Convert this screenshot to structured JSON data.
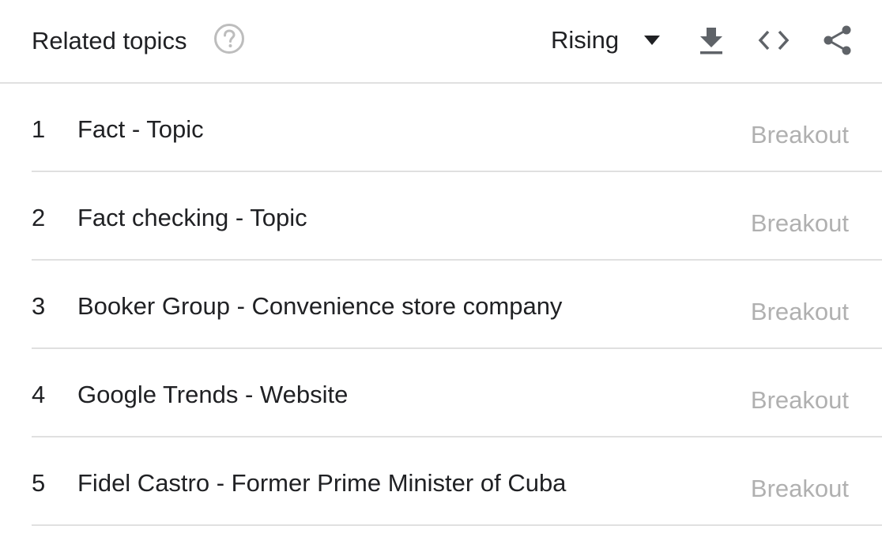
{
  "header": {
    "title": "Related topics",
    "help_icon": "help-circle-icon",
    "filter": {
      "selected": "Rising",
      "icon": "caret-down-icon"
    },
    "actions": [
      {
        "name": "download",
        "icon": "download-icon"
      },
      {
        "name": "embed",
        "icon": "code-icon"
      },
      {
        "name": "share",
        "icon": "share-icon"
      }
    ]
  },
  "topics": [
    {
      "rank": "1",
      "title": "Fact - Topic",
      "value": "Breakout"
    },
    {
      "rank": "2",
      "title": "Fact checking - Topic",
      "value": "Breakout"
    },
    {
      "rank": "3",
      "title": "Booker Group - Convenience store company",
      "value": "Breakout"
    },
    {
      "rank": "4",
      "title": "Google Trends - Website",
      "value": "Breakout"
    },
    {
      "rank": "5",
      "title": "Fidel Castro - Former Prime Minister of Cuba",
      "value": "Breakout"
    }
  ],
  "colors": {
    "text": "#202124",
    "muted": "#b0b0b0",
    "icon": "#5f6368",
    "divider": "#e0e0e0"
  }
}
